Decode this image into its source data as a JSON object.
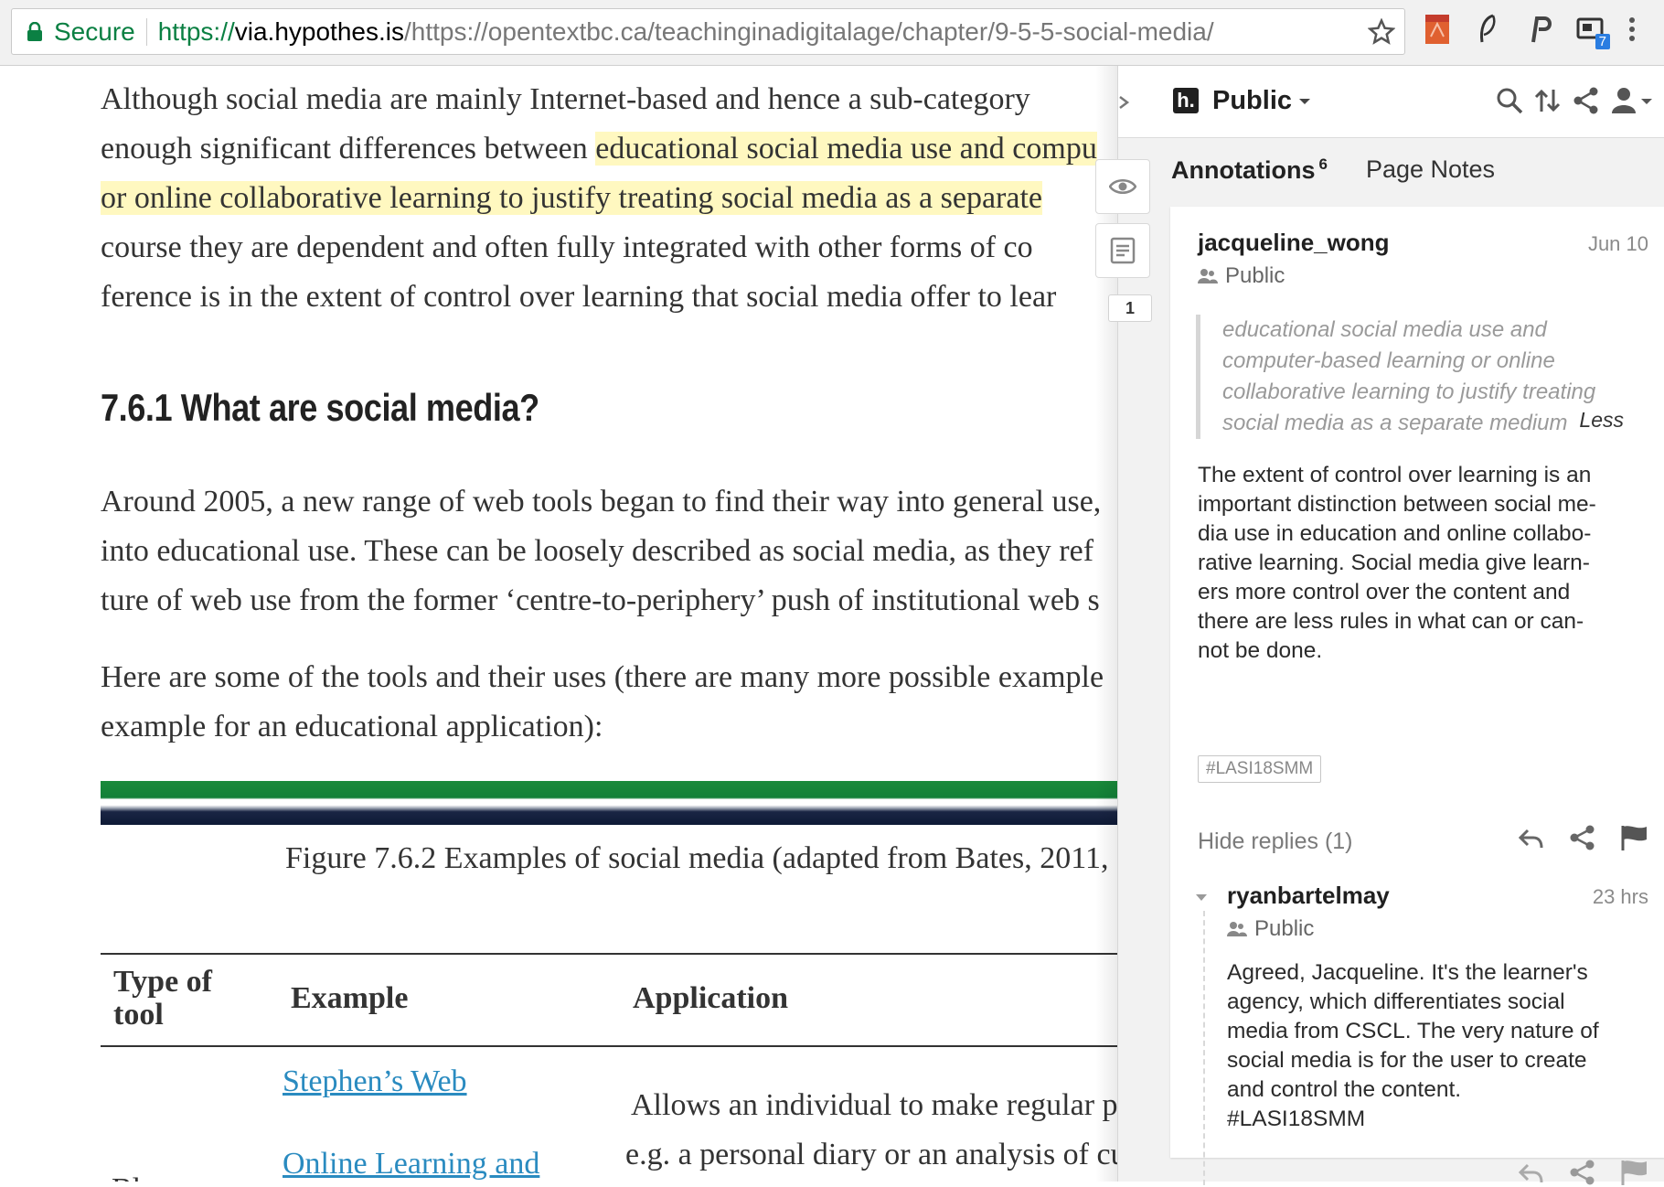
{
  "browser": {
    "secure_label": "Secure",
    "url_scheme": "https://",
    "url_host": "via.hypothes.is",
    "url_path": "/https://opentextbc.ca/teachinginadigitalage/chapter/9-5-5-social-media/",
    "extension_badge": "7"
  },
  "page": {
    "paragraph1": [
      {
        "plain": "Although social media are mainly Internet-based and hence a sub-category",
        "hl": ""
      },
      {
        "plain": "enough significant differences between ",
        "hl": "educational social media use and compu"
      },
      {
        "plain": "",
        "hl": "or online collaborative learning to justify treating social media as a separate"
      },
      {
        "plain": "course they are dependent and often fully integrated with other forms of co",
        "hl": ""
      },
      {
        "plain": "ference is in the extent of control over learning that social media offer to lear",
        "hl": ""
      }
    ],
    "heading": "7.6.1 What are social media?",
    "paragraph2": [
      "Around 2005, a new range of web tools began to find their way into general use,",
      "into educational use. These can be loosely described as social media, as they ref",
      "ture of web use from the former ‘centre-to-periphery’ push of institutional web s"
    ],
    "paragraph3": [
      "Here are some of the tools and their uses (there are many more possible example",
      "example for an educational application):"
    ],
    "figure_caption": "Figure 7.6.2 Examples of social media (adapted from Bates, 2011,",
    "table": {
      "headers": [
        "Type of tool",
        "Example",
        "Application"
      ],
      "row1": {
        "links": [
          "Stephen’s Web",
          "Online Learning and"
        ],
        "application_lines": [
          "Allows an individual to make regular po",
          "e.g. a personal diary or an analysis of cu"
        ],
        "type_partial": "Bl"
      }
    }
  },
  "sidebar": {
    "group": "Public",
    "count_badge": "1",
    "tabs": [
      {
        "label": "Annotations",
        "count": "6"
      },
      {
        "label": "Page Notes"
      }
    ],
    "annotation": {
      "user": "jacqueline_wong",
      "date": "Jun 10",
      "visibility": "Public",
      "quote_lines": [
        "educational social media use and",
        "computer-based learning or online",
        "collaborative learning to justify treating",
        "social media as a separate medium"
      ],
      "less_label": "Less",
      "body_lines": [
        "The extent of control over learning is an",
        "important distinction between social me-",
        "dia use in education and online collabo-",
        "rative learning. Social media give learn-",
        "ers more control over the content and",
        "there are less rules in what can or can-",
        "not be done."
      ],
      "tag": "#LASI18SMM",
      "hide_replies": "Hide replies (1)"
    },
    "reply": {
      "user": "ryanbartelmay",
      "date": "23 hrs",
      "visibility": "Public",
      "body_lines": [
        "Agreed, Jacqueline. It's the learner's",
        "agency, which differentiates social",
        "media from CSCL. The very nature of",
        "social media is for the user to create",
        "and control the content.",
        "#LASI18SMM"
      ]
    }
  },
  "colors": {
    "secure_green": "#0b8043",
    "highlight_yellow": "#fff8c0",
    "link_blue": "#2a8bc0",
    "banner_green": "#128037",
    "banner_navy": "#0e1a36"
  },
  "icons": [
    "lock-icon",
    "star-icon",
    "pdf-extension-icon",
    "feather-extension-icon",
    "p-extension-icon",
    "cast-extension-icon",
    "menu-dots-icon",
    "hypothesis-logo-icon",
    "search-icon",
    "sort-icon",
    "share-icon",
    "user-icon",
    "eye-icon",
    "note-icon",
    "reply-icon",
    "flag-icon",
    "group-icon",
    "chevron-right-icon"
  ]
}
